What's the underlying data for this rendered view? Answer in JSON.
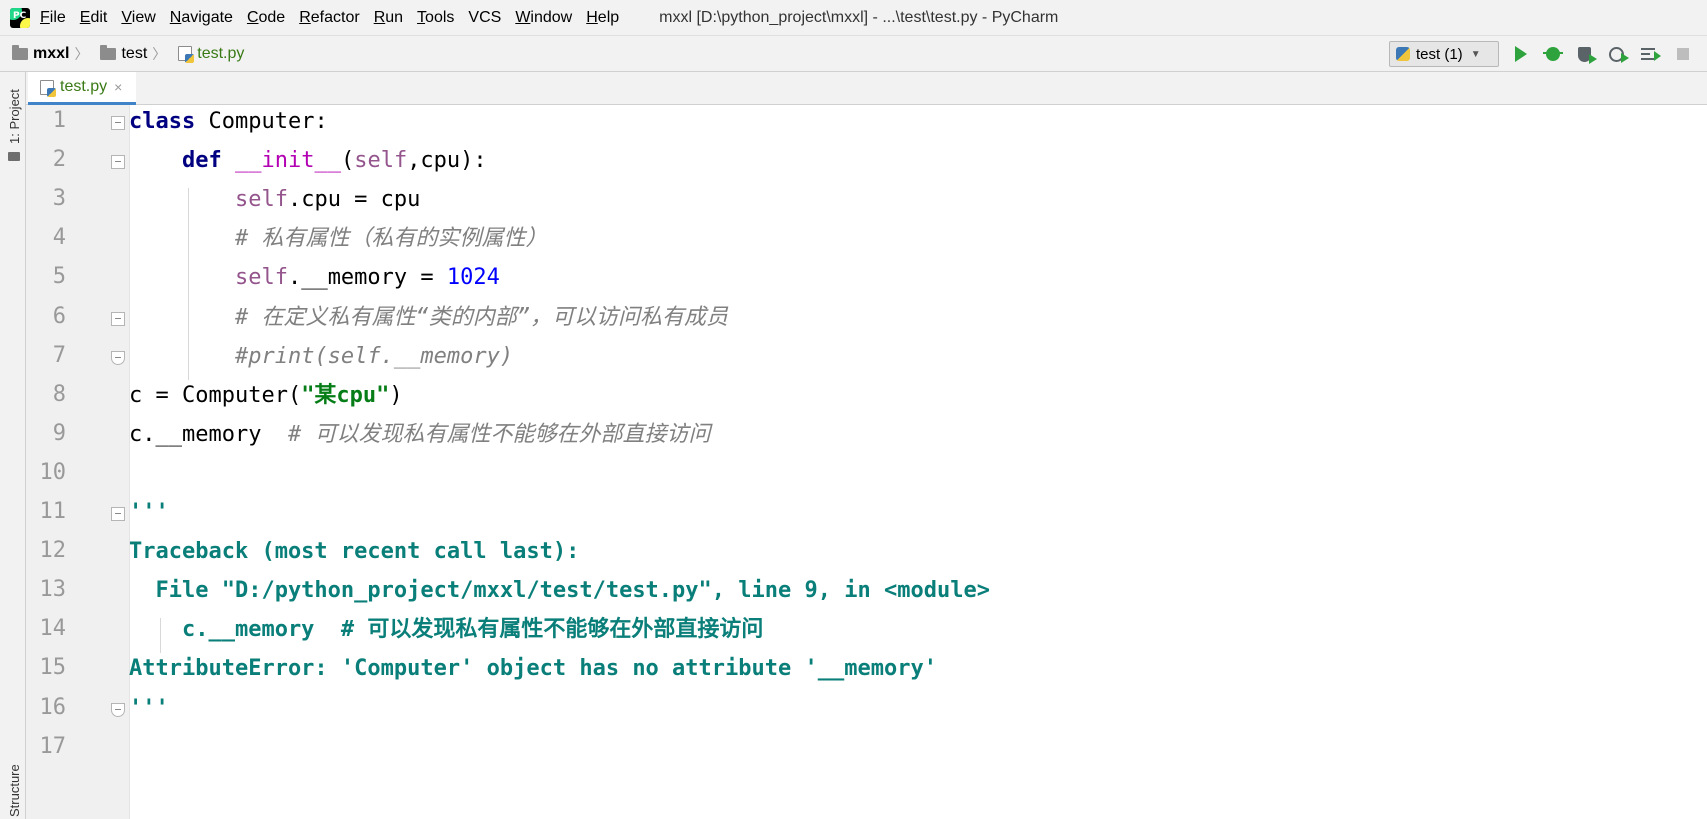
{
  "window": {
    "logo_text": "PC",
    "title": "mxxl [D:\\python_project\\mxxl] - ...\\test\\test.py - PyCharm"
  },
  "menu": [
    {
      "mnemonic": "F",
      "rest": "ile"
    },
    {
      "mnemonic": "E",
      "rest": "dit"
    },
    {
      "mnemonic": "V",
      "rest": "iew"
    },
    {
      "mnemonic": "N",
      "rest": "avigate"
    },
    {
      "mnemonic": "C",
      "rest": "ode"
    },
    {
      "mnemonic": "R",
      "rest": "efactor"
    },
    {
      "mnemonic": "R",
      "rest": "un"
    },
    {
      "mnemonic": "T",
      "rest": "ools"
    },
    {
      "mnemonic": "",
      "rest": "VCS"
    },
    {
      "mnemonic": "W",
      "rest": "indow"
    },
    {
      "mnemonic": "H",
      "rest": "elp"
    }
  ],
  "breadcrumb": [
    "mxxl",
    "test",
    "test.py"
  ],
  "run_config": {
    "label": "test (1)"
  },
  "tool_windows": {
    "project": "1: Project",
    "structure": "Structure"
  },
  "tab": {
    "label": "test.py",
    "close": "×"
  },
  "editor": {
    "line_numbers": [
      "1",
      "2",
      "3",
      "4",
      "5",
      "6",
      "7",
      "8",
      "9",
      "10",
      "11",
      "12",
      "13",
      "14",
      "15",
      "16",
      "17"
    ],
    "lines": [
      [
        {
          "t": "class",
          "c": "kw"
        },
        {
          "t": " Computer:",
          "c": ""
        }
      ],
      [
        {
          "t": "    ",
          "c": ""
        },
        {
          "t": "def",
          "c": "kw"
        },
        {
          "t": " ",
          "c": ""
        },
        {
          "t": "__init__",
          "c": "magic"
        },
        {
          "t": "(",
          "c": ""
        },
        {
          "t": "self",
          "c": "selfc"
        },
        {
          "t": ",cpu):",
          "c": ""
        }
      ],
      [
        {
          "t": "        ",
          "c": ""
        },
        {
          "t": "self",
          "c": "selfc"
        },
        {
          "t": ".cpu = cpu",
          "c": ""
        }
      ],
      [
        {
          "t": "        ",
          "c": ""
        },
        {
          "t": "# 私有属性（私有的实例属性）",
          "c": "cmt"
        }
      ],
      [
        {
          "t": "        ",
          "c": ""
        },
        {
          "t": "self",
          "c": "selfc"
        },
        {
          "t": ".__memory = ",
          "c": ""
        },
        {
          "t": "1024",
          "c": "num"
        }
      ],
      [
        {
          "t": "        ",
          "c": ""
        },
        {
          "t": "# 在定义私有属性“类的内部”，可以访问私有成员",
          "c": "cmt"
        }
      ],
      [
        {
          "t": "        ",
          "c": ""
        },
        {
          "t": "#print(self.__memory)",
          "c": "cmt"
        }
      ],
      [
        {
          "t": "c = Computer(",
          "c": ""
        },
        {
          "t": "\"某cpu\"",
          "c": "str"
        },
        {
          "t": ")",
          "c": ""
        }
      ],
      [
        {
          "t": "c.__memory  ",
          "c": ""
        },
        {
          "t": "# 可以发现私有属性不能够在外部直接访问",
          "c": "cmt"
        }
      ],
      [],
      [
        {
          "t": "'''",
          "c": "doc"
        }
      ],
      [
        {
          "t": "Traceback (most recent call last):",
          "c": "doc"
        }
      ],
      [
        {
          "t": "  File \"D:/python_project/mxxl/test/test.py\", line 9, in <module>",
          "c": "doc"
        }
      ],
      [
        {
          "t": "    c.__memory  # 可以发现私有属性不能够在外部直接访问",
          "c": "doc"
        }
      ],
      [
        {
          "t": "AttributeError: 'Computer' object has no attribute '__memory'",
          "c": "doc"
        }
      ],
      [
        {
          "t": "'''",
          "c": "doc"
        }
      ],
      []
    ]
  }
}
